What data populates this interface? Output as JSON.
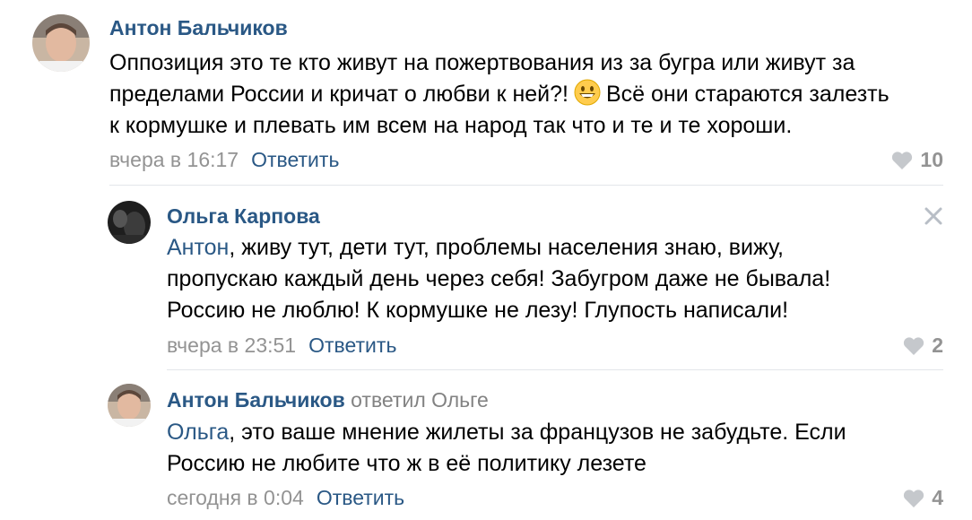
{
  "comments": [
    {
      "author": "Антон Бальчиков",
      "lines": [
        "Оппозиция это те кто живут на пожертвования из за бугра или живут за",
        "пределами России и кричат о любви к ней?!",
        "Всё они стараются залезть",
        "к кормушке и плевать им всем на народ так что и те и те хороши."
      ],
      "emoji": "grinning-face-icon",
      "time": "вчера в 16:17",
      "reply_label": "Ответить",
      "likes": "10"
    },
    {
      "author": "Ольга Карпова",
      "mention": "Антон",
      "lines": [
        ", живу тут, дети тут, проблемы населения знаю, вижу,",
        "пропускаю каждый день через себя! Забугром даже не бывала!",
        "Россию не люблю! К кормушке не лезу! Глупость написали!"
      ],
      "time": "вчера в 23:51",
      "reply_label": "Ответить",
      "likes": "2",
      "close_icon": "close-icon"
    },
    {
      "author": "Антон Бальчиков",
      "replied_to": "ответил Ольге",
      "mention": "Ольга",
      "lines": [
        ", это ваше мнение жилеты за французов не забудьте. Если",
        "Россию не любите что ж в её политику лезете"
      ],
      "time": "сегодня в 0:04",
      "reply_label": "Ответить",
      "likes": "4"
    }
  ],
  "colors": {
    "link": "#2a5885",
    "meta": "#939393",
    "divider": "#e3e6ea"
  }
}
